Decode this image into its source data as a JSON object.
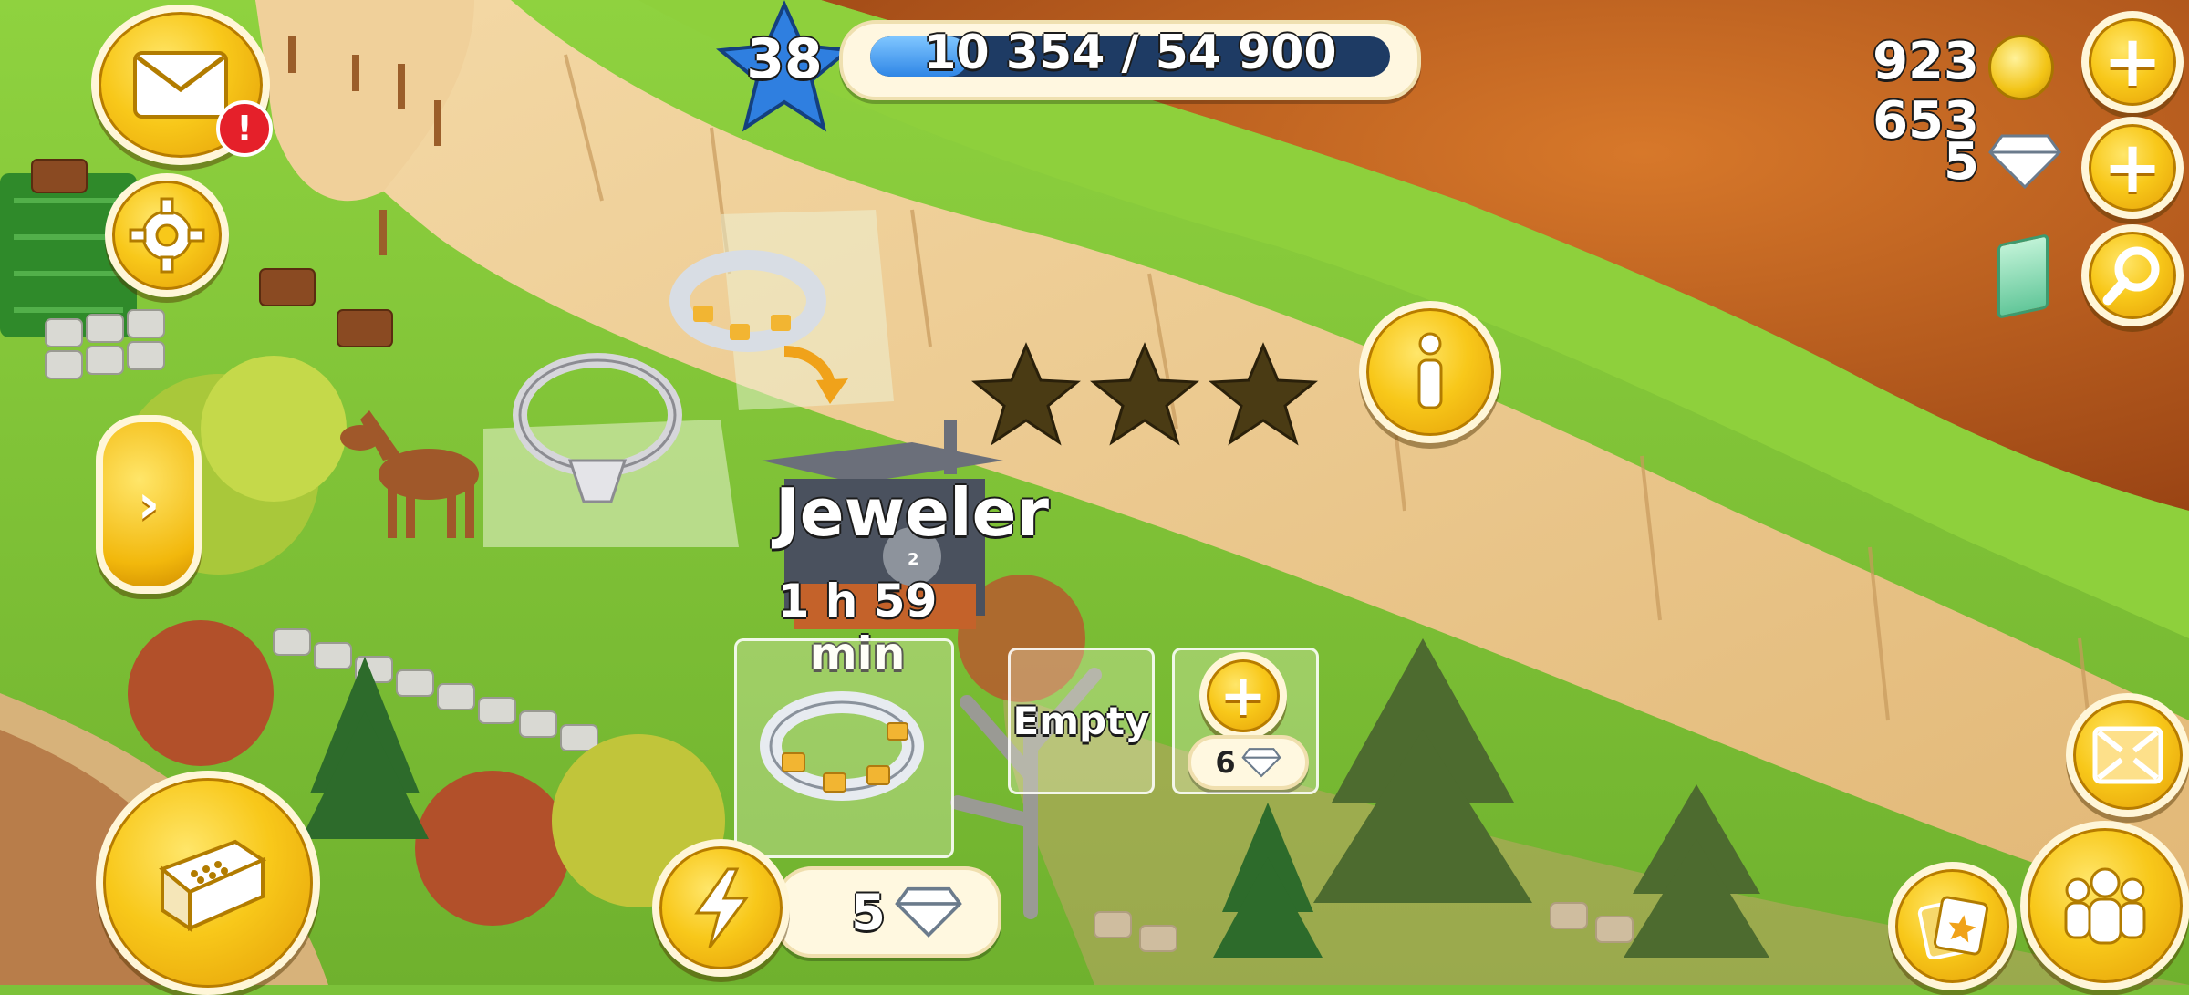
{
  "hud": {
    "level": "38",
    "xp_text": "10 354 / 54 900",
    "xp_progress": 0.1886,
    "coins": "923 653",
    "diamonds": "5"
  },
  "building": {
    "name": "Jeweler",
    "timer": "1 h 59 min",
    "stars_filled": 0,
    "stars_total": 3,
    "queue_badge": "2",
    "empty_slot_label": "Empty",
    "unlock_slot_cost": "6",
    "speed_up_cost": "5"
  },
  "colors": {
    "accent_yellow": "#f8c81a",
    "xp_bar": "#3b9cf0",
    "alert_red": "#e5202a",
    "autumn_orange": "#c8651e"
  },
  "icons": {
    "mail": "mail-icon",
    "settings": "gear-icon",
    "side_panel": "chevron-right-icon",
    "shop": "cash-register-icon",
    "info": "info-icon",
    "search": "magnifier-icon",
    "speed_up": "lightning-icon",
    "friends": "friends-icon",
    "cards": "cards-icon",
    "expand": "expand-icon"
  }
}
